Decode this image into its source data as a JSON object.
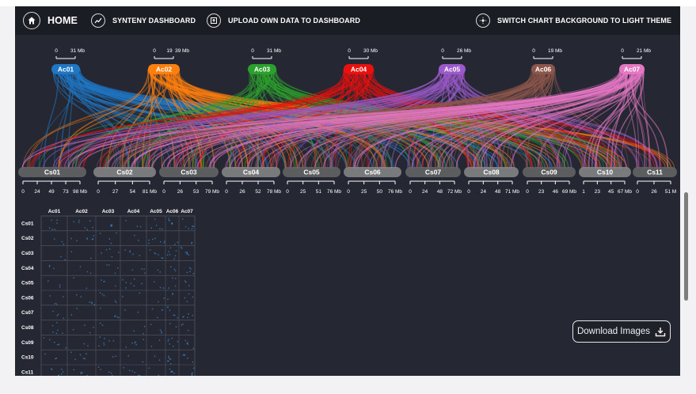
{
  "nav": {
    "home": "HOME",
    "synteny": "SYNTENY DASHBOARD",
    "upload": "UPLOAD OWN DATA TO DASHBOARD",
    "theme": "SWITCH CHART BACKGROUND TO LIGHT THEME"
  },
  "download_label": "Download Images",
  "colors": {
    "background": "#252833",
    "navbar": "#1b1d24",
    "Ac01": "#1f77c4",
    "Ac02": "#ff7f0e",
    "Ac03": "#2ca02c",
    "Ac04": "#e8110f",
    "Ac05": "#9b59c9",
    "Ac06": "#8c564b",
    "Ac07": "#e377c2",
    "target_chrom": "#666666",
    "target_chrom_alt": "#888888"
  },
  "icons": {
    "home": "home-icon",
    "synteny": "chart-line-icon",
    "upload": "upload-icon",
    "theme": "sun-icon",
    "download": "download-icon"
  },
  "chart_data": [
    {
      "type": "synteny-linear",
      "top_chromosomes": [
        {
          "name": "Ac01",
          "ticks": [
            "0",
            "31 Mb"
          ]
        },
        {
          "name": "Ac02",
          "ticks": [
            "0",
            "19",
            "39 Mb"
          ]
        },
        {
          "name": "Ac03",
          "ticks": [
            "0",
            "31 Mb"
          ]
        },
        {
          "name": "Ac04",
          "ticks": [
            "0",
            "30 Mb"
          ]
        },
        {
          "name": "Ac05",
          "ticks": [
            "0",
            "26 Mb"
          ]
        },
        {
          "name": "Ac06",
          "ticks": [
            "0",
            "19 Mb"
          ]
        },
        {
          "name": "Ac07",
          "ticks": [
            "0",
            "21 Mb"
          ]
        }
      ],
      "bottom_chromosomes": [
        {
          "name": "Cs01",
          "ticks": [
            "0",
            "24",
            "49",
            "73",
            "98 Mb"
          ]
        },
        {
          "name": "Cs02",
          "ticks": [
            "0",
            "27",
            "54",
            "81 Mb"
          ]
        },
        {
          "name": "Cs03",
          "ticks": [
            "0",
            "26",
            "53",
            "79 Mb"
          ]
        },
        {
          "name": "Cs04",
          "ticks": [
            "0",
            "26",
            "52",
            "78 Mb"
          ]
        },
        {
          "name": "Cs05",
          "ticks": [
            "0",
            "25",
            "51",
            "76 Mb"
          ]
        },
        {
          "name": "Cs06",
          "ticks": [
            "0",
            "25",
            "50",
            "76 Mb"
          ]
        },
        {
          "name": "Cs07",
          "ticks": [
            "0",
            "24",
            "48",
            "72 Mb"
          ]
        },
        {
          "name": "Cs08",
          "ticks": [
            "0",
            "24",
            "48",
            "71 Mb"
          ]
        },
        {
          "name": "Cs09",
          "ticks": [
            "0",
            "23",
            "46",
            "69 Mb"
          ]
        },
        {
          "name": "Cs10",
          "ticks": [
            "1",
            "23",
            "45",
            "67 Mb"
          ]
        },
        {
          "name": "Cs11",
          "ticks": [
            "0",
            "26",
            "51 M"
          ]
        }
      ]
    },
    {
      "type": "dotplot",
      "columns": [
        "Ac01",
        "Ac02",
        "Ac03",
        "Ac04",
        "Ac05",
        "Ac06",
        "Ac07"
      ],
      "rows": [
        "Cs01",
        "Cs02",
        "Cs03",
        "Cs04",
        "Cs05",
        "Cs06",
        "Cs07",
        "Cs08",
        "Cs09",
        "Cs10",
        "Cs11"
      ]
    }
  ]
}
